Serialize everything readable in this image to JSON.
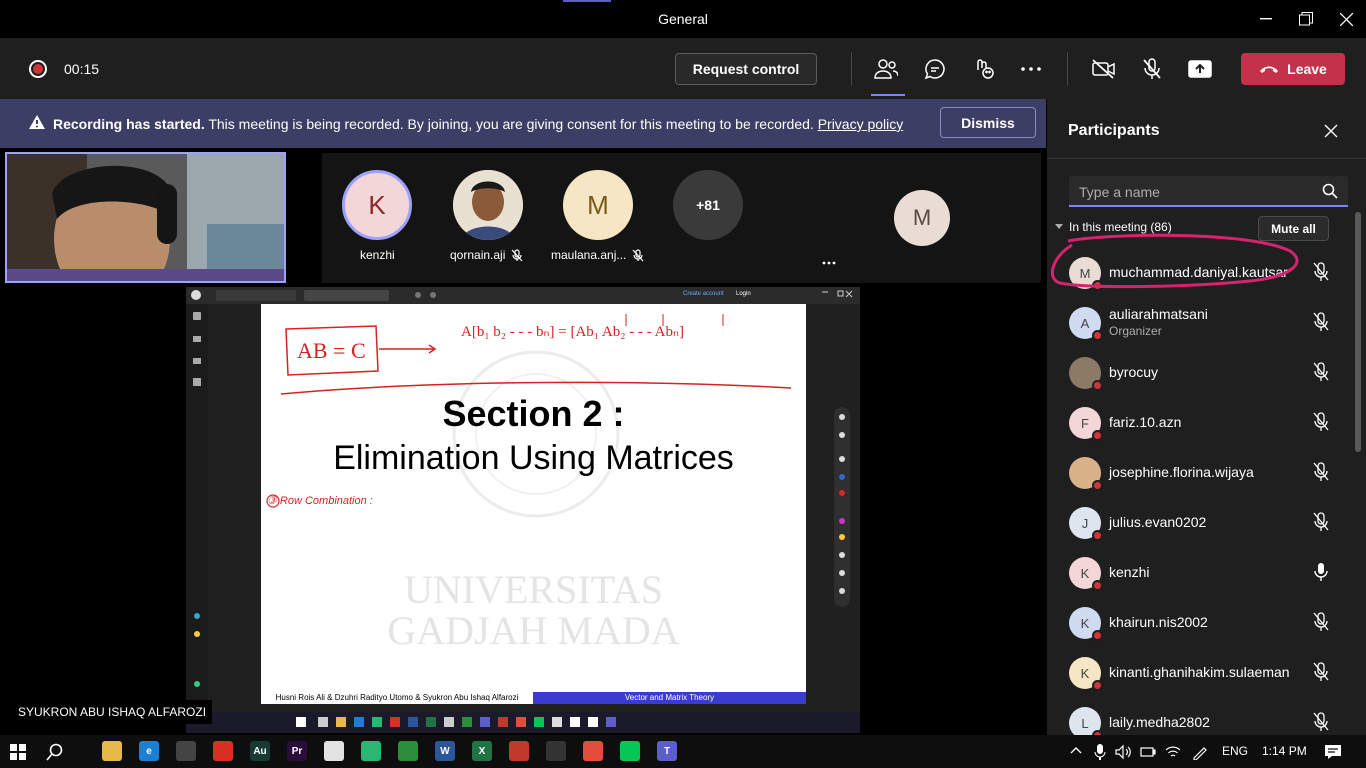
{
  "window": {
    "title": "General"
  },
  "toolbar": {
    "timer": "00:15",
    "request_control": "Request control",
    "leave": "Leave"
  },
  "banner": {
    "bold": "Recording has started.",
    "message": "This meeting is being recorded. By joining, you are giving consent for this meeting to be recorded.",
    "privacy": "Privacy policy",
    "dismiss": "Dismiss"
  },
  "stage": {
    "tiles": [
      {
        "initial": "K",
        "name": "kenzhi",
        "bg": "#f3d6d8",
        "color": "#8a2a2a"
      },
      {
        "initial": "",
        "name": "qornain.aji",
        "bg": "#c49a6c",
        "color": "#fff"
      },
      {
        "initial": "M",
        "name": "maulana.anj...",
        "bg": "#f6e6c4",
        "color": "#7a5a18"
      }
    ],
    "overflow": "+81",
    "right_initial": "M",
    "presenter": "SYUKRON ABU ISHAQ ALFAROZI",
    "slide": {
      "title": "Section 2 :",
      "subtitle": "Elimination Using Matrices",
      "watermark_1": "UNIVERSITAS",
      "watermark_2": "GADJAH MADA",
      "footer_left": "Husni Rois Ali & Dzuhri Radityo Utomo & Syukron Abu Ishaq Alfarozi",
      "footer_right": "Vector and Matrix Theory",
      "ink_1": "AB = C",
      "ink_2": "A[b₁ b₂ - - - bₙ] = [Ab₁  Ab₂ - - - Abₙ]",
      "ink_3": "③ Row Combination :"
    },
    "share_chrome": {
      "create": "Create account",
      "login": "Login"
    }
  },
  "panel": {
    "title": "Participants",
    "search_placeholder": "Type a name",
    "section": "In this meeting (86)",
    "mute_all": "Mute all",
    "participants": [
      {
        "initial": "M",
        "name": "muchammad.daniyal.kautsar",
        "role": "",
        "bg": "#e8dcd5",
        "mic": "muted"
      },
      {
        "initial": "A",
        "name": "auliarahmatsani",
        "role": "Organizer",
        "bg": "#cfdbf0",
        "mic": "muted"
      },
      {
        "initial": "",
        "name": "byrocuy",
        "role": "",
        "bg": "#8a7a66",
        "mic": "muted"
      },
      {
        "initial": "F",
        "name": "fariz.10.azn",
        "role": "",
        "bg": "#f3d6d8",
        "mic": "muted"
      },
      {
        "initial": "",
        "name": "josephine.florina.wijaya",
        "role": "",
        "bg": "#d9b28a",
        "mic": "muted"
      },
      {
        "initial": "J",
        "name": "julius.evan0202",
        "role": "",
        "bg": "#dde6ee",
        "mic": "muted"
      },
      {
        "initial": "K",
        "name": "kenzhi",
        "role": "",
        "bg": "#f3d6d8",
        "mic": "on"
      },
      {
        "initial": "K",
        "name": "khairun.nis2002",
        "role": "",
        "bg": "#cfdbf0",
        "mic": "muted"
      },
      {
        "initial": "K",
        "name": "kinanti.ghanihakim.sulaeman",
        "role": "",
        "bg": "#f6e6c4",
        "mic": "muted"
      },
      {
        "initial": "L",
        "name": "laily.medha2802",
        "role": "",
        "bg": "#dde6ee",
        "mic": "muted"
      }
    ]
  },
  "taskbar": {
    "lang": "ENG",
    "time": "1:14 PM",
    "apps": [
      {
        "label": "",
        "bg": "#e8b84a"
      },
      {
        "label": "e",
        "bg": "#1d7fd1"
      },
      {
        "label": "",
        "bg": "#444"
      },
      {
        "label": "",
        "bg": "#d93025"
      },
      {
        "label": "Au",
        "bg": "#153b32"
      },
      {
        "label": "Pr",
        "bg": "#2a0d3a"
      },
      {
        "label": "",
        "bg": "#e3e3e3"
      },
      {
        "label": "",
        "bg": "#2bb673"
      },
      {
        "label": "",
        "bg": "#2c8e3b"
      },
      {
        "label": "W",
        "bg": "#2b579a"
      },
      {
        "label": "X",
        "bg": "#217346"
      },
      {
        "label": "",
        "bg": "#c0392b"
      },
      {
        "label": "",
        "bg": "#333"
      },
      {
        "label": "",
        "bg": "#e24d3c"
      },
      {
        "label": "",
        "bg": "#06c755"
      },
      {
        "label": "T",
        "bg": "#5b5fc7"
      }
    ]
  },
  "colors": {
    "accent": "#7f85f5",
    "leave": "#c4314b",
    "banner": "#3d3e66",
    "recording": "#d13438",
    "annotation": "#d6236e"
  }
}
